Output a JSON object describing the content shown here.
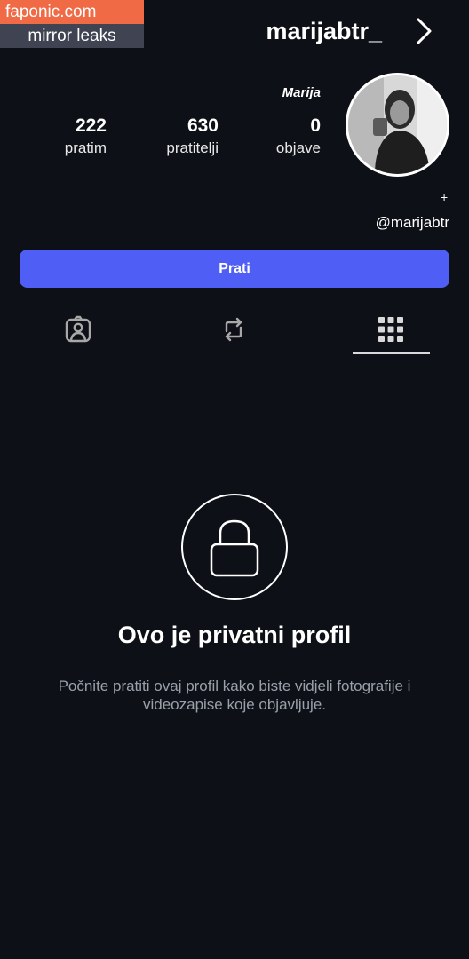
{
  "watermark": {
    "site": "faponic.com",
    "tagline": "mirror leaks"
  },
  "profile": {
    "username": "marijabtr_",
    "display_name": "Marija",
    "plus_symbol": "+",
    "handle": "@marijabtr",
    "stats": [
      {
        "value": "0",
        "label": "objave"
      },
      {
        "value": "630",
        "label": "pratitelji"
      },
      {
        "value": "222",
        "label": "pratim"
      }
    ]
  },
  "actions": {
    "follow_label": "Prati"
  },
  "tabs": [
    {
      "icon": "grid-icon",
      "active": true
    },
    {
      "icon": "repost-icon",
      "active": false
    },
    {
      "icon": "tagged-user-icon",
      "active": false
    }
  ],
  "private_notice": {
    "icon": "lock-icon",
    "title": "Ovo je privatni profil",
    "description": "Počnite pratiti ovaj profil kako biste vidjeli fotografije i videozapise koje objavljuje."
  },
  "colors": {
    "background": "#0d1016",
    "accent": "#4f5ff5",
    "watermark_orange": "#f06a45",
    "watermark_gray": "#3f4352"
  }
}
